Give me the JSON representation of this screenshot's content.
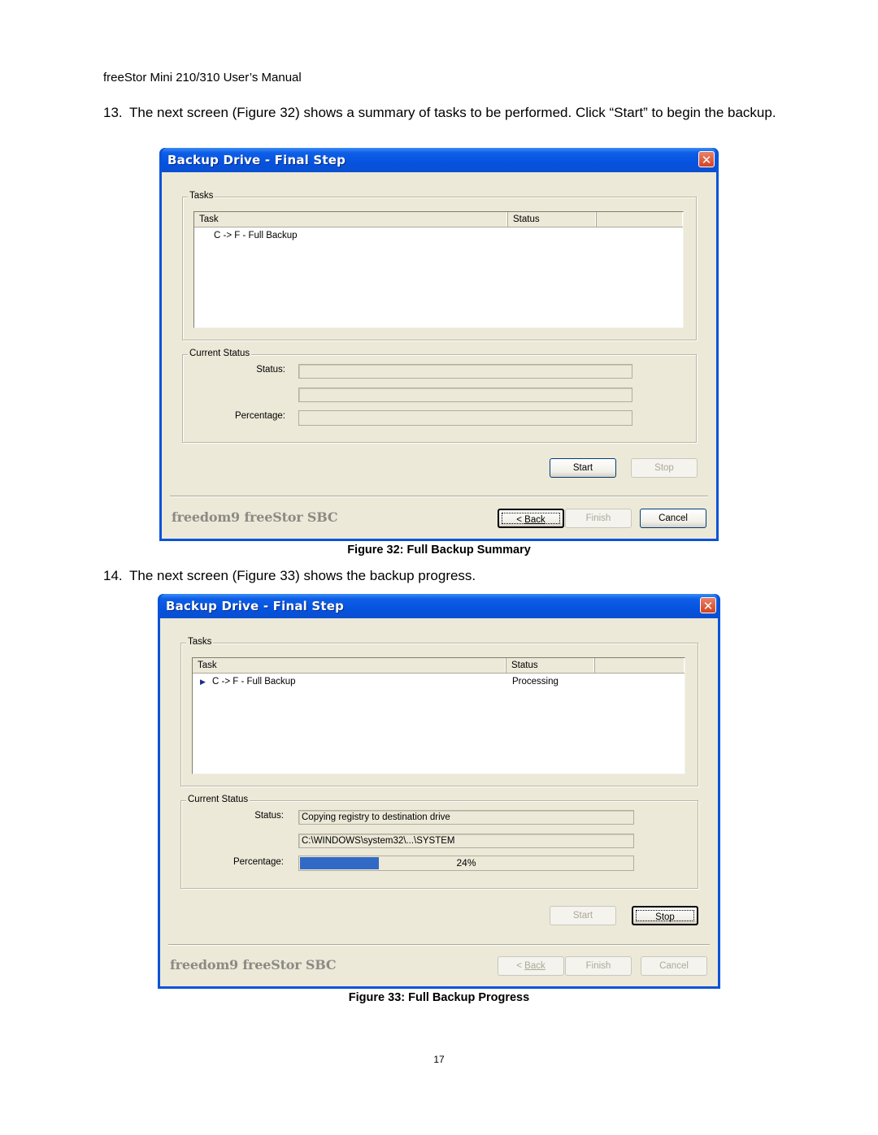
{
  "page": {
    "header": "freeStor Mini 210/310 User’s Manual",
    "steps": [
      {
        "number": "13.",
        "text": "The next screen (Figure 32) shows a summary of tasks to be performed. Click “Start” to begin the backup."
      },
      {
        "number": "14.",
        "text": "The next screen (Figure 33) shows the backup progress."
      }
    ],
    "captions": [
      "Figure 32: Full Backup Summary",
      "Figure 33: Full Backup Progress"
    ],
    "page_number": "17"
  },
  "figures": [
    {
      "window_title": "Backup Drive - Final Step",
      "close_icon": "✕",
      "tasks_group_label": "Tasks",
      "columns": [
        "Task",
        "Status",
        ""
      ],
      "rows": [
        {
          "task": "C -> F - Full Backup",
          "status": "",
          "active": false
        }
      ],
      "current_status_label": "Current Status",
      "status_label": "Status:",
      "percentage_label": "Percentage:",
      "status_value": "",
      "file_value": "",
      "progress_percent": 0,
      "progress_text": "",
      "buttons": {
        "start": "Start",
        "stop": "Stop",
        "back_prefix": "< ",
        "back": "Back",
        "finish": "Finish",
        "cancel": "Cancel"
      },
      "button_states": {
        "start": "enabled",
        "stop": "disabled",
        "back": "enabled-focused",
        "finish": "disabled",
        "cancel": "enabled"
      },
      "brand": "freedom9 freeStor SBC"
    },
    {
      "window_title": "Backup Drive - Final Step",
      "close_icon": "✕",
      "tasks_group_label": "Tasks",
      "columns": [
        "Task",
        "Status",
        ""
      ],
      "rows": [
        {
          "task": "C -> F - Full Backup",
          "status": "Processing",
          "active": true,
          "marker_icon": "▶"
        }
      ],
      "current_status_label": "Current Status",
      "status_label": "Status:",
      "percentage_label": "Percentage:",
      "status_value": "Copying registry to destination drive",
      "file_value": "C:\\WINDOWS\\system32\\...\\SYSTEM",
      "progress_percent": 24,
      "progress_text": "24%",
      "buttons": {
        "start": "Start",
        "stop": "Stop",
        "back_prefix": "< ",
        "back": "Back",
        "finish": "Finish",
        "cancel": "Cancel"
      },
      "button_states": {
        "start": "disabled",
        "stop": "enabled-focused",
        "back": "disabled",
        "finish": "disabled",
        "cancel": "disabled"
      },
      "brand": "freedom9 freeStor SBC"
    }
  ]
}
